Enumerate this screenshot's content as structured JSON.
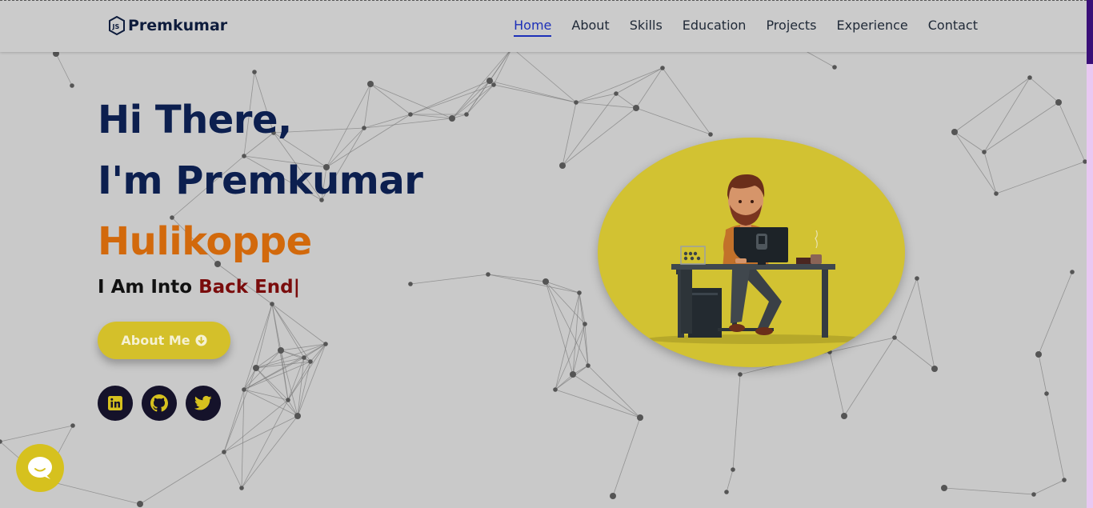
{
  "header": {
    "logo_icon": "js-logo-icon",
    "brand": "Premkumar",
    "nav": [
      {
        "label": "Home",
        "active": true
      },
      {
        "label": "About",
        "active": false
      },
      {
        "label": "Skills",
        "active": false
      },
      {
        "label": "Education",
        "active": false
      },
      {
        "label": "Projects",
        "active": false
      },
      {
        "label": "Experience",
        "active": false
      },
      {
        "label": "Contact",
        "active": false
      }
    ]
  },
  "hero": {
    "greeting": "Hi There,",
    "name_line": "I'm Premkumar",
    "surname": "Hulikoppe",
    "typing_prefix": "I Am Into ",
    "typing_role": "Back End|",
    "button_label": "About Me",
    "button_icon": "arrow-circle-down-icon"
  },
  "social": [
    {
      "name": "linkedin",
      "icon": "linkedin-icon"
    },
    {
      "name": "github",
      "icon": "github-icon"
    },
    {
      "name": "twitter",
      "icon": "twitter-icon"
    }
  ],
  "chat": {
    "icon": "chat-bubble-icon"
  },
  "colors": {
    "navy": "#0c1f4f",
    "orange": "#d2690c",
    "accent_yellow": "#d4c02a",
    "active_nav": "#1d30b8",
    "role_red": "#7a0c0c",
    "background": "#c9c9c9"
  }
}
